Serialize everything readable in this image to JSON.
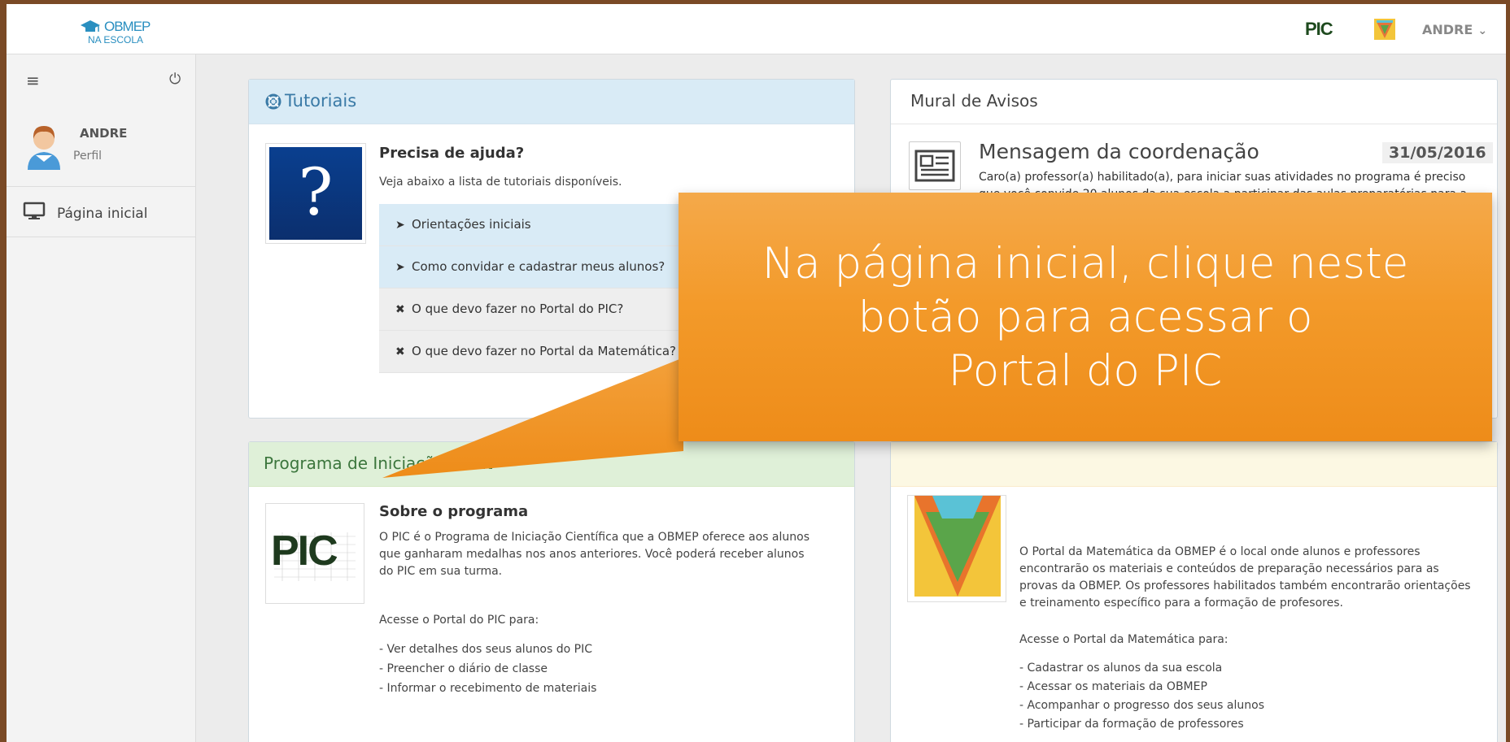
{
  "topnav": {
    "logo_line1": "OBMEP",
    "logo_line2": "NA ESCOLA",
    "pic_label": "PIC",
    "user_label": "ANDRE"
  },
  "sidebar": {
    "user_name": "ANDRE",
    "profile_label": "Perfil",
    "home_label": "Página inicial"
  },
  "tutoriais": {
    "title": "Tutoriais",
    "help_title": "Precisa de ajuda?",
    "help_subtitle": "Veja abaixo a lista de tutoriais disponíveis.",
    "items": [
      {
        "label": "Orientações iniciais",
        "icon": "circle-play-icon"
      },
      {
        "label": "Como convidar e cadastrar meus alunos?",
        "icon": "circle-play-icon"
      },
      {
        "label": "O que devo fazer no Portal do PIC?",
        "icon": "x-icon"
      },
      {
        "label": "O que devo fazer no Portal da Matemática?",
        "icon": "x-icon"
      }
    ]
  },
  "mural": {
    "title": "Mural de Avisos",
    "message_title": "Mensagem da coordenação",
    "message_date": "31/05/2016",
    "message_body": "Caro(a) professor(a) habilitado(a), para iniciar suas atividades no programa é preciso que você convide 20 alunos da sua escola a participar das aulas preparatórias para a prova da OBMEP. Para saber como fazer isso, veja os"
  },
  "pic_panel": {
    "title": "Programa de Iniciação Cient",
    "logo_text": "PIC",
    "about_title": "Sobre o programa",
    "about_body": "O PIC é o Programa de Iniciação Científica que a OBMEP oferece aos alunos que ganharam medalhas nos anos anteriores. Você poderá receber alunos do PIC em sua turma.",
    "access_label": "Acesse o Portal do PIC para:",
    "bullets": [
      "- Ver detalhes dos seus alunos do PIC",
      "- Preencher o diário de classe",
      "- Informar o recebimento de materiais"
    ]
  },
  "pm_panel": {
    "body": "O Portal da Matemática da OBMEP é o local onde alunos e professores encontrarão os materiais e conteúdos de preparação necessários para as provas da OBMEP. Os professores habilitados também encontrarão orientações e treinamento específico para a formação de profesores.",
    "access_label": "Acesse o Portal da Matemática para:",
    "bullets": [
      "- Cadastrar os alunos da sua escola",
      "- Acessar os materiais da OBMEP",
      "- Acompanhar o progresso dos seus alunos",
      "- Participar da formação de professores"
    ]
  },
  "callout": {
    "line1": "Na página inicial, clique neste",
    "line2": "botão para acessar o",
    "line3": "Portal do PIC"
  },
  "colors": {
    "callout_orange": "#f39a2a",
    "info_blue": "#d9ebf6",
    "success_green": "#dff0d8",
    "frame_brown": "#7a4a26"
  }
}
